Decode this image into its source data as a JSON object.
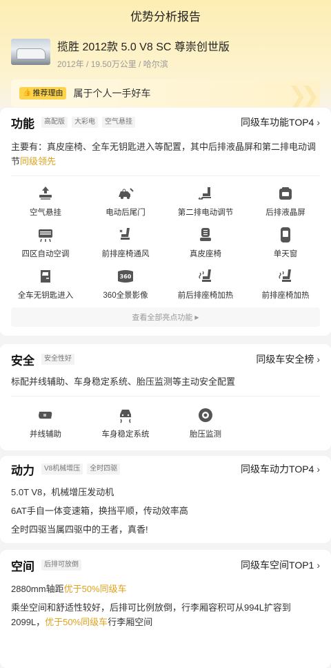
{
  "header": {
    "title": "优势分析报告"
  },
  "car": {
    "title": "揽胜 2012款 5.0 V8 SC 尊崇创世版",
    "meta": "2012年 / 19.50万公里 / 哈尔滨"
  },
  "reason": {
    "tag": "推荐理由",
    "text": "属于个人一手好车"
  },
  "function": {
    "title": "功能",
    "badges": [
      "高配版",
      "大彩电",
      "空气悬挂"
    ],
    "rank": "同级车功能TOP4",
    "desc_main": "主要有：真皮座椅、全车无钥匙进入等配置，其中后排液晶屏和第二排电动调节",
    "desc_hl": "同级领先",
    "items": [
      "空气悬挂",
      "电动后尾门",
      "第二排电动调节",
      "后排液晶屏",
      "四区自动空调",
      "前排座椅通风",
      "真皮座椅",
      "单天窗",
      "全车无钥匙进入",
      "360全景影像",
      "前后排座椅加热",
      "前排座椅加热"
    ],
    "more": "查看全部亮点功能"
  },
  "safety": {
    "title": "安全",
    "badges": [
      "安全性好"
    ],
    "rank": "同级车安全榜",
    "desc": "标配并线辅助、车身稳定系统、胎压监测等主动安全配置",
    "items": [
      "并线辅助",
      "车身稳定系统",
      "胎压监测"
    ]
  },
  "power": {
    "title": "动力",
    "badges": [
      "V8机械增压",
      "全时四驱"
    ],
    "rank": "同级车动力TOP4",
    "lines": [
      "5.0T V8，机械增压发动机",
      "6AT手自一体变速箱，换挡平顺，传动效率高",
      "全时四驱当属四驱中的王者，真香!"
    ]
  },
  "space": {
    "title": "空间",
    "badges": [
      "后排可放倒"
    ],
    "rank": "同级车空间TOP1",
    "line1_a": "2880mm轴距",
    "line1_hl": "优于50%同级车",
    "line2_a": "乘坐空间和舒适性较好，后排可比例放倒，行李厢容积可从994L扩容到2099L，",
    "line2_hl": "优于50%同级车",
    "line2_b": "行李厢空间"
  },
  "colors": {
    "accent": "#e0a21c",
    "tag": "#fcd34a"
  }
}
